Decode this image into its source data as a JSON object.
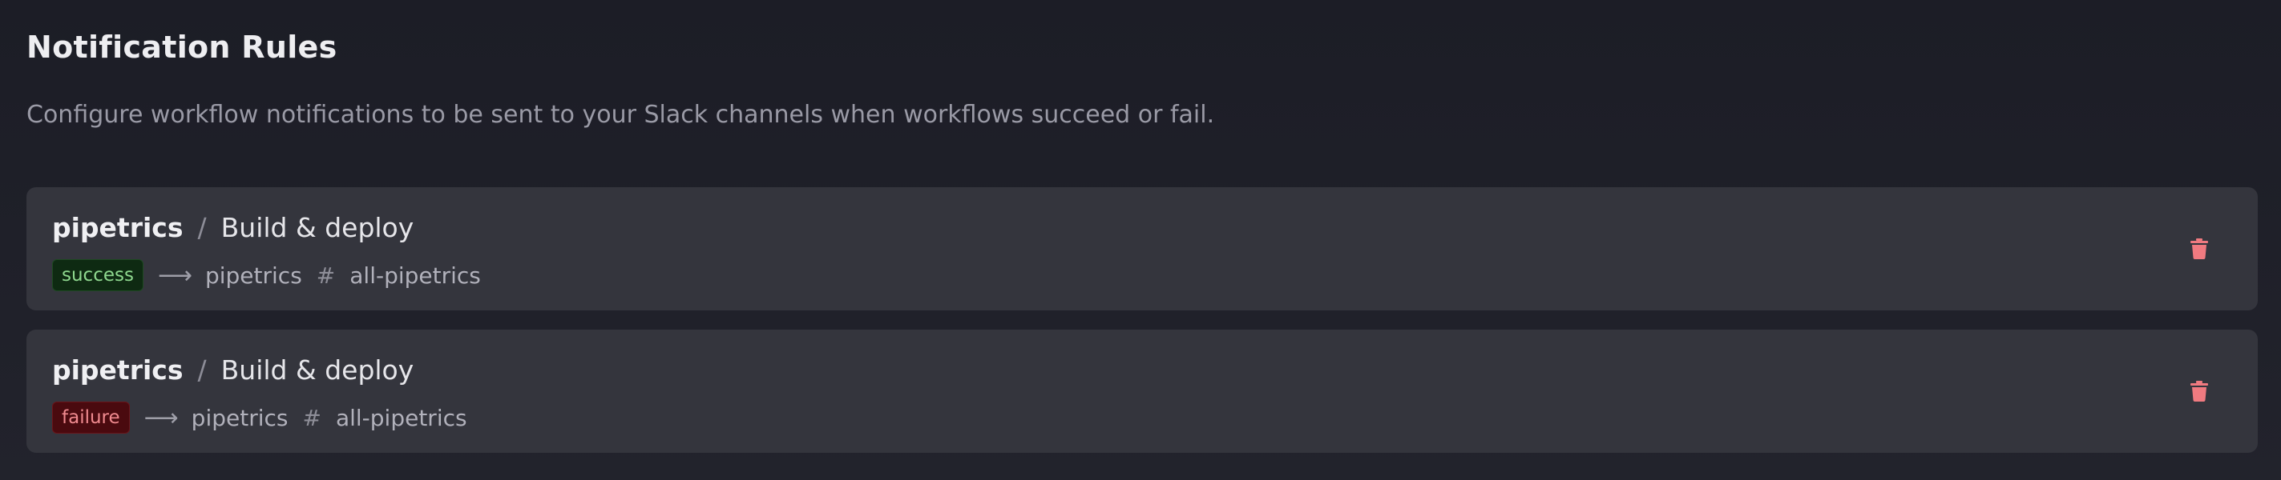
{
  "header": {
    "title": "Notification Rules",
    "description": "Configure workflow notifications to be sent to your Slack channels when workflows succeed or fail."
  },
  "rules": [
    {
      "org": "pipetrics",
      "separator": "/",
      "workflow": "Build & deploy",
      "status": "success",
      "arrow": "⟶",
      "slack_workspace": "pipetrics",
      "hash": "#",
      "channel": "all-pipetrics",
      "delete_icon": "trash-icon"
    },
    {
      "org": "pipetrics",
      "separator": "/",
      "workflow": "Build & deploy",
      "status": "failure",
      "arrow": "⟶",
      "slack_workspace": "pipetrics",
      "hash": "#",
      "channel": "all-pipetrics",
      "delete_icon": "trash-icon"
    }
  ],
  "colors": {
    "background": "#1f2029",
    "card": "#34353d",
    "success_badge_bg": "#0e2a12",
    "success_badge_text": "#8fd88f",
    "failure_badge_bg": "#4a0a0f",
    "failure_badge_text": "#f08a8f",
    "delete_icon": "#f07a80"
  }
}
